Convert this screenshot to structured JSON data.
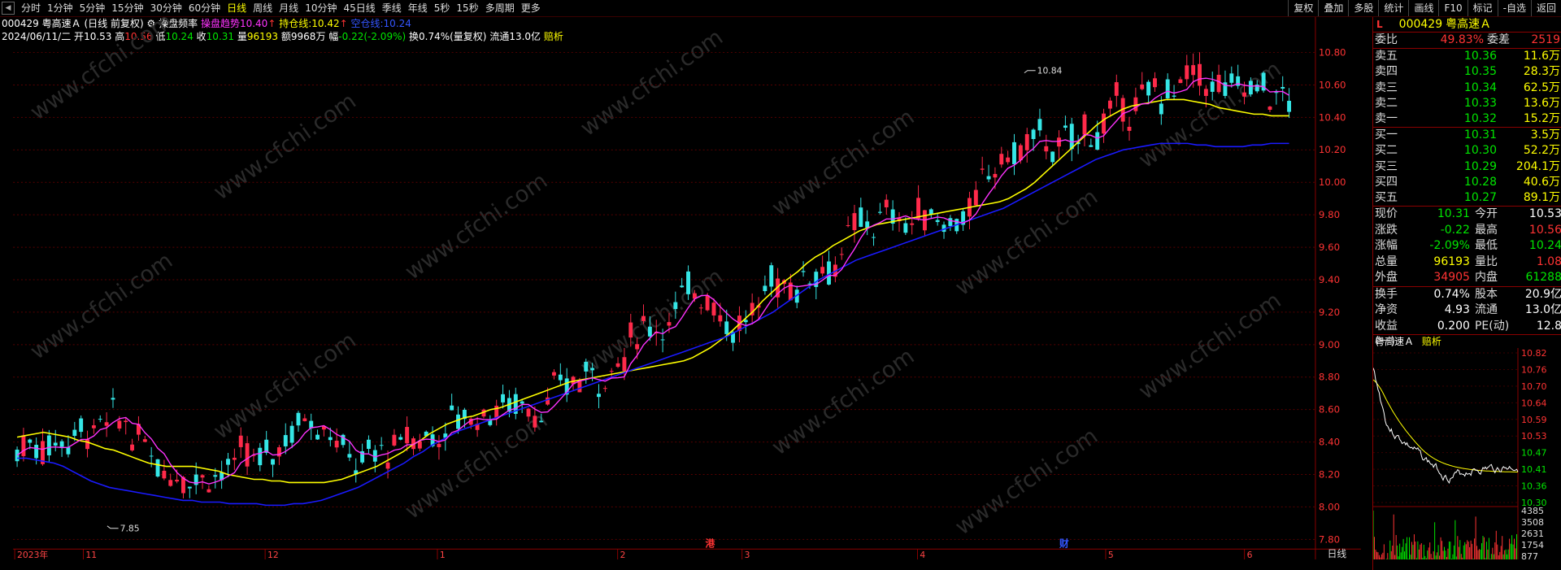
{
  "toolbar": {
    "periods": [
      "分时",
      "1分钟",
      "5分钟",
      "15分钟",
      "30分钟",
      "60分钟",
      "日线",
      "周线",
      "月线",
      "10分钟",
      "45日线",
      "季线",
      "年线",
      "5秒",
      "15秒",
      "多周期",
      "更多"
    ],
    "active_index": 6,
    "right_buttons": [
      "复权",
      "叠加",
      "多股",
      "统计",
      "画线",
      "F10",
      "标记",
      "-自选",
      "返回"
    ]
  },
  "info_line1": {
    "code": "000429",
    "name": "粤高速Ａ",
    "mode": "(日线 前复权)",
    "indicator": "操盘频率",
    "trend_label": "操盘趋势",
    "trend_val": "10.40",
    "hold_label": "持仓线:",
    "hold_val": "10.42",
    "empty_label": "空仓线:",
    "empty_val": "10.24"
  },
  "info_line2": {
    "date": "2024/06/11/二",
    "open_label": "开",
    "open": "10.53",
    "high_label": "高",
    "high": "10.56",
    "low_label": "低",
    "low": "10.24",
    "close_label": "收",
    "close": "10.31",
    "vol_label": "量",
    "vol": "96193",
    "amt_label": "额",
    "amt": "9968万",
    "chg_label": "幅",
    "chg": "-0.22(-2.09%)",
    "turnover": "换0.74%(量复权)",
    "float": "流通13.0亿",
    "tag": "赔析"
  },
  "chart_data": {
    "type": "candlestick",
    "y_ticks": [
      "10.80",
      "10.60",
      "10.40",
      "10.20",
      "10.00",
      "9.80",
      "9.60",
      "9.40",
      "9.20",
      "9.00",
      "8.80",
      "8.60",
      "8.40",
      "8.20",
      "8.00",
      "7.80"
    ],
    "x_labels": [
      "2023年",
      "11",
      "12",
      "1",
      "2",
      "3",
      "4",
      "5",
      "6"
    ],
    "annotations": {
      "high": "10.84",
      "low": "7.85"
    },
    "markers": [
      "港",
      "财"
    ],
    "period_label": "日线",
    "ylim": [
      7.76,
      10.92
    ],
    "yellow_line": [
      8.43,
      8.44,
      8.45,
      8.46,
      8.45,
      8.44,
      8.43,
      8.41,
      8.4,
      8.38,
      8.36,
      8.35,
      8.33,
      8.31,
      8.29,
      8.27,
      8.26,
      8.25,
      8.25,
      8.25,
      8.25,
      8.24,
      8.23,
      8.22,
      8.2,
      8.19,
      8.18,
      8.17,
      8.17,
      8.16,
      8.16,
      8.15,
      8.15,
      8.15,
      8.15,
      8.15,
      8.16,
      8.17,
      8.19,
      8.21,
      8.23,
      8.25,
      8.28,
      8.31,
      8.34,
      8.38,
      8.41,
      8.45,
      8.48,
      8.51,
      8.53,
      8.55,
      8.56,
      8.58,
      8.6,
      8.61,
      8.63,
      8.65,
      8.67,
      8.69,
      8.71,
      8.73,
      8.75,
      8.77,
      8.78,
      8.79,
      8.8,
      8.81,
      8.82,
      8.83,
      8.84,
      8.85,
      8.86,
      8.87,
      8.88,
      8.89,
      8.9,
      8.92,
      8.95,
      8.98,
      9.02,
      9.06,
      9.11,
      9.16,
      9.21,
      9.27,
      9.32,
      9.37,
      9.41,
      9.45,
      9.5,
      9.54,
      9.57,
      9.61,
      9.64,
      9.67,
      9.7,
      9.72,
      9.74,
      9.75,
      9.76,
      9.77,
      9.78,
      9.79,
      9.8,
      9.81,
      9.82,
      9.83,
      9.84,
      9.85,
      9.86,
      9.87,
      9.88,
      9.9,
      9.93,
      9.96,
      10.0,
      10.05,
      10.1,
      10.15,
      10.2,
      10.25,
      10.3,
      10.35,
      10.39,
      10.42,
      10.45,
      10.47,
      10.48,
      10.49,
      10.5,
      10.51,
      10.51,
      10.51,
      10.5,
      10.49,
      10.48,
      10.46,
      10.45,
      10.44,
      10.43,
      10.42,
      10.42,
      10.41,
      10.41,
      10.41
    ],
    "blue_line": [
      8.3,
      8.3,
      8.29,
      8.28,
      8.27,
      8.25,
      8.22,
      8.19,
      8.16,
      8.14,
      8.12,
      8.11,
      8.1,
      8.09,
      8.08,
      8.07,
      8.06,
      8.05,
      8.04,
      8.04,
      8.03,
      8.03,
      8.03,
      8.02,
      8.02,
      8.02,
      8.02,
      8.01,
      8.01,
      8.01,
      8.02,
      8.02,
      8.03,
      8.04,
      8.06,
      8.08,
      8.1,
      8.12,
      8.15,
      8.18,
      8.21,
      8.24,
      8.27,
      8.31,
      8.34,
      8.38,
      8.41,
      8.44,
      8.47,
      8.49,
      8.51,
      8.53,
      8.55,
      8.57,
      8.59,
      8.61,
      8.63,
      8.65,
      8.67,
      8.69,
      8.71,
      8.73,
      8.75,
      8.77,
      8.79,
      8.81,
      8.83,
      8.85,
      8.87,
      8.89,
      8.91,
      8.93,
      8.95,
      8.97,
      8.99,
      9.01,
      9.03,
      9.05,
      9.08,
      9.11,
      9.14,
      9.17,
      9.2,
      9.24,
      9.28,
      9.32,
      9.36,
      9.4,
      9.43,
      9.46,
      9.49,
      9.52,
      9.54,
      9.56,
      9.58,
      9.6,
      9.62,
      9.64,
      9.66,
      9.68,
      9.7,
      9.72,
      9.74,
      9.76,
      9.78,
      9.8,
      9.82,
      9.84,
      9.87,
      9.9,
      9.93,
      9.96,
      9.99,
      10.02,
      10.05,
      10.08,
      10.11,
      10.14,
      10.16,
      10.18,
      10.2,
      10.21,
      10.22,
      10.23,
      10.24,
      10.24,
      10.24,
      10.24,
      10.23,
      10.23,
      10.22,
      10.22,
      10.22,
      10.22,
      10.23,
      10.23,
      10.24,
      10.24,
      10.24
    ]
  },
  "right_panel": {
    "header": {
      "flag": "L",
      "code": "000429",
      "name": "粤高速Ａ"
    },
    "weibi": {
      "label": "委比",
      "pct": "49.83%",
      "label2": "委差",
      "val": "2519"
    },
    "asks": [
      {
        "label": "卖五",
        "price": "10.36",
        "vol": "11.6万"
      },
      {
        "label": "卖四",
        "price": "10.35",
        "vol": "28.3万"
      },
      {
        "label": "卖三",
        "price": "10.34",
        "vol": "62.5万"
      },
      {
        "label": "卖二",
        "price": "10.33",
        "vol": "13.6万"
      },
      {
        "label": "卖一",
        "price": "10.32",
        "vol": "15.2万"
      }
    ],
    "bids": [
      {
        "label": "买一",
        "price": "10.31",
        "vol": "3.5万"
      },
      {
        "label": "买二",
        "price": "10.30",
        "vol": "52.2万"
      },
      {
        "label": "买三",
        "price": "10.29",
        "vol": "204.1万"
      },
      {
        "label": "买四",
        "price": "10.28",
        "vol": "40.6万"
      },
      {
        "label": "买五",
        "price": "10.27",
        "vol": "89.1万"
      }
    ],
    "stats1": [
      {
        "k": "现价",
        "v": "10.31",
        "k2": "今开",
        "v2": "10.53"
      },
      {
        "k": "涨跌",
        "v": "-0.22",
        "k2": "最高",
        "v2": "10.56"
      },
      {
        "k": "涨幅",
        "v": "-2.09%",
        "k2": "最低",
        "v2": "10.24"
      },
      {
        "k": "总量",
        "v": "96193",
        "k2": "量比",
        "v2": "1.08"
      },
      {
        "k": "外盘",
        "v": "34905",
        "k2": "内盘",
        "v2": "61288"
      }
    ],
    "stats2": [
      {
        "k": "换手",
        "v": "0.74%",
        "k2": "股本",
        "v2": "20.9亿"
      },
      {
        "k": "净资",
        "v": "4.93",
        "k2": "流通",
        "v2": "13.0亿"
      },
      {
        "k": "收益(一)",
        "v": "0.200",
        "k2": "PE(动)",
        "v2": "12.8"
      }
    ],
    "mini": {
      "name": "粤高速Ａ",
      "tag": "赔析",
      "y_ticks": [
        "10.82",
        "10.76",
        "10.70",
        "10.64",
        "10.59",
        "10.53",
        "10.47",
        "10.41",
        "10.36",
        "10.30"
      ],
      "vol_ticks": [
        "4385",
        "3508",
        "2631",
        "1754",
        "877"
      ]
    }
  },
  "watermark": "www.cfchi.com",
  "colors": {
    "up": "#ff2a4a",
    "down": "#35e6e6",
    "ma_yellow": "#ffff00",
    "ma_blue": "#1a1aff",
    "ma_magenta": "#ff33ff",
    "grid": "#8b0000"
  }
}
